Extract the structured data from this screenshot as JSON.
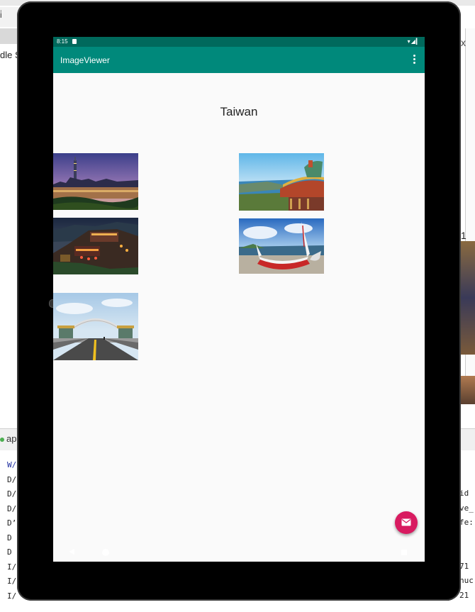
{
  "ide": {
    "toolbar_label": "i̇",
    "side_text": "dle S",
    "bottom_tab": "ap",
    "right_x": "x",
    "right_one": "1",
    "log_lines": [
      "W/",
      "D/",
      "D/",
      "D/",
      "D’",
      "D",
      "D",
      "I/",
      "I/",
      "I/"
    ],
    "log_right": [
      "id",
      "ve_",
      "fe:",
      "",
      "",
      "71",
      "nuc",
      "21"
    ]
  },
  "status_bar": {
    "time": "8:15",
    "icons": "▾◢▎"
  },
  "app_bar": {
    "title": "ImageViewer",
    "menu_icon": "more-vert-icon"
  },
  "main": {
    "heading": "Taiwan",
    "photos": [
      {
        "subject": "Taipei 101 city night skyline"
      },
      {
        "subject": "Temple roof overlooking harbor"
      },
      {
        "subject": "Jiufen old street at night"
      },
      {
        "subject": "Tao canoe on beach"
      },
      {
        "subject": "Arch gate over road"
      }
    ]
  },
  "fab": {
    "icon": "email-icon",
    "color": "#d81b60"
  },
  "nav": {
    "back_icon": "back-triangle-icon",
    "home_icon": "home-circle-icon",
    "recents_icon": "recents-square-icon"
  },
  "colors": {
    "primary": "#00897b",
    "primary_dark": "#00695c",
    "accent": "#d81b60"
  }
}
